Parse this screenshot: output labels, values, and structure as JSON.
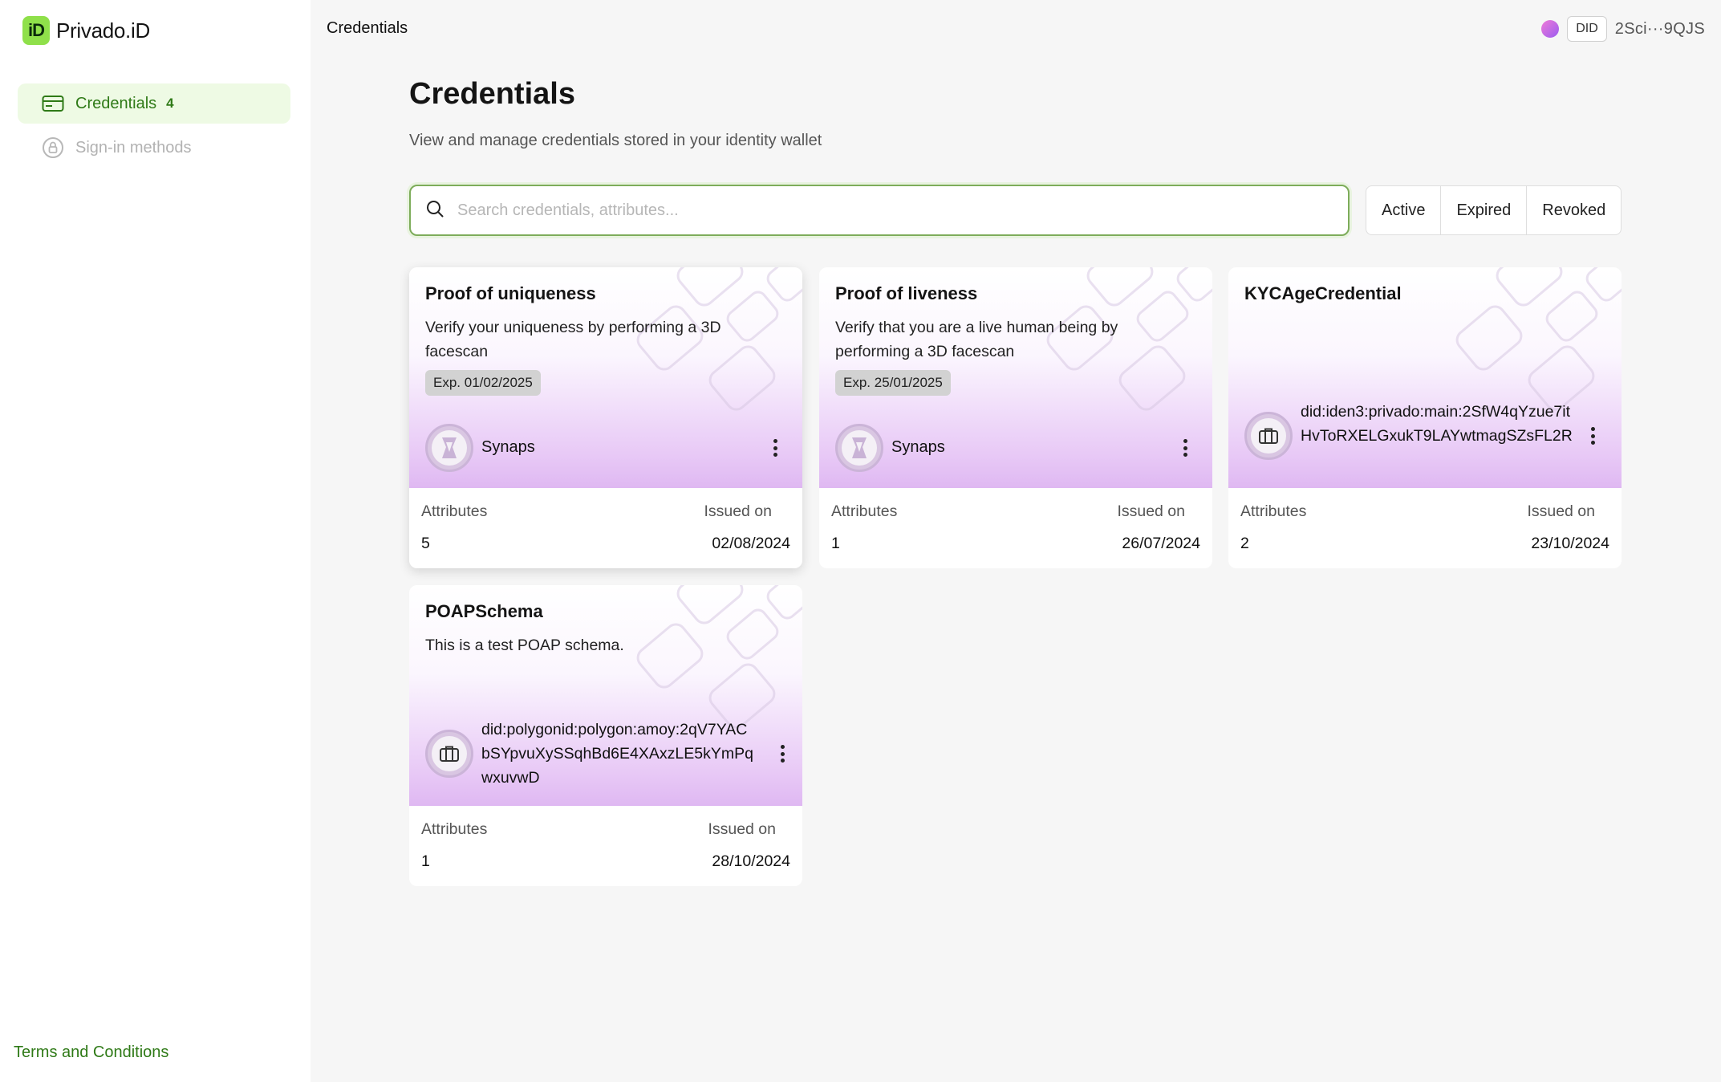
{
  "brand": {
    "name": "Privado.iD",
    "mark": "iD",
    "accent": "#2f7a17"
  },
  "sidebar": {
    "items": [
      {
        "label": "Credentials",
        "badge": "4",
        "icon": "credit-card-icon",
        "active": true
      },
      {
        "label": "Sign-in methods",
        "icon": "lock-icon",
        "active": false
      }
    ],
    "footer_link": "Terms and Conditions"
  },
  "header": {
    "title": "Credentials",
    "did_label": "DID",
    "did_short": "2Sci···9QJS"
  },
  "main": {
    "title": "Credentials",
    "subtitle": "View and manage credentials stored in your identity wallet",
    "search": {
      "placeholder": "Search credentials, attributes...",
      "value": ""
    },
    "filters": [
      "Active",
      "Expired",
      "Revoked"
    ],
    "footer_labels": {
      "attributes": "Attributes",
      "issued_on": "Issued on"
    }
  },
  "cards": [
    {
      "title": "Proof of uniqueness",
      "description": "Verify your uniqueness by performing a 3D facescan",
      "expiry": "Exp. 01/02/2025",
      "issuer": "Synaps",
      "issuer_icon": "synaps-logo-icon",
      "attributes": "5",
      "issued_on": "02/08/2024"
    },
    {
      "title": "Proof of liveness",
      "description": "Verify that you are a live human being by performing a 3D facescan",
      "expiry": "Exp. 25/01/2025",
      "issuer": "Synaps",
      "issuer_icon": "synaps-logo-icon",
      "attributes": "1",
      "issued_on": "26/07/2024"
    },
    {
      "title": "KYCAgeCredential",
      "description": "",
      "expiry": "",
      "issuer": "did:iden3:privado:main:2SfW4qYzue7itHvToRXELGxukT9LAYwtmagSZsFL2R",
      "issuer_icon": "briefcase-icon",
      "attributes": "2",
      "issued_on": "23/10/2024"
    },
    {
      "title": "POAPSchema",
      "description": "This is a test POAP schema.",
      "expiry": "",
      "issuer": "did:polygonid:polygon:amoy:2qV7YACbSYpvuXySSqhBd6E4XAxzLE5kYmPqwxuvwD",
      "issuer_icon": "briefcase-icon",
      "attributes": "1",
      "issued_on": "28/10/2024"
    }
  ]
}
